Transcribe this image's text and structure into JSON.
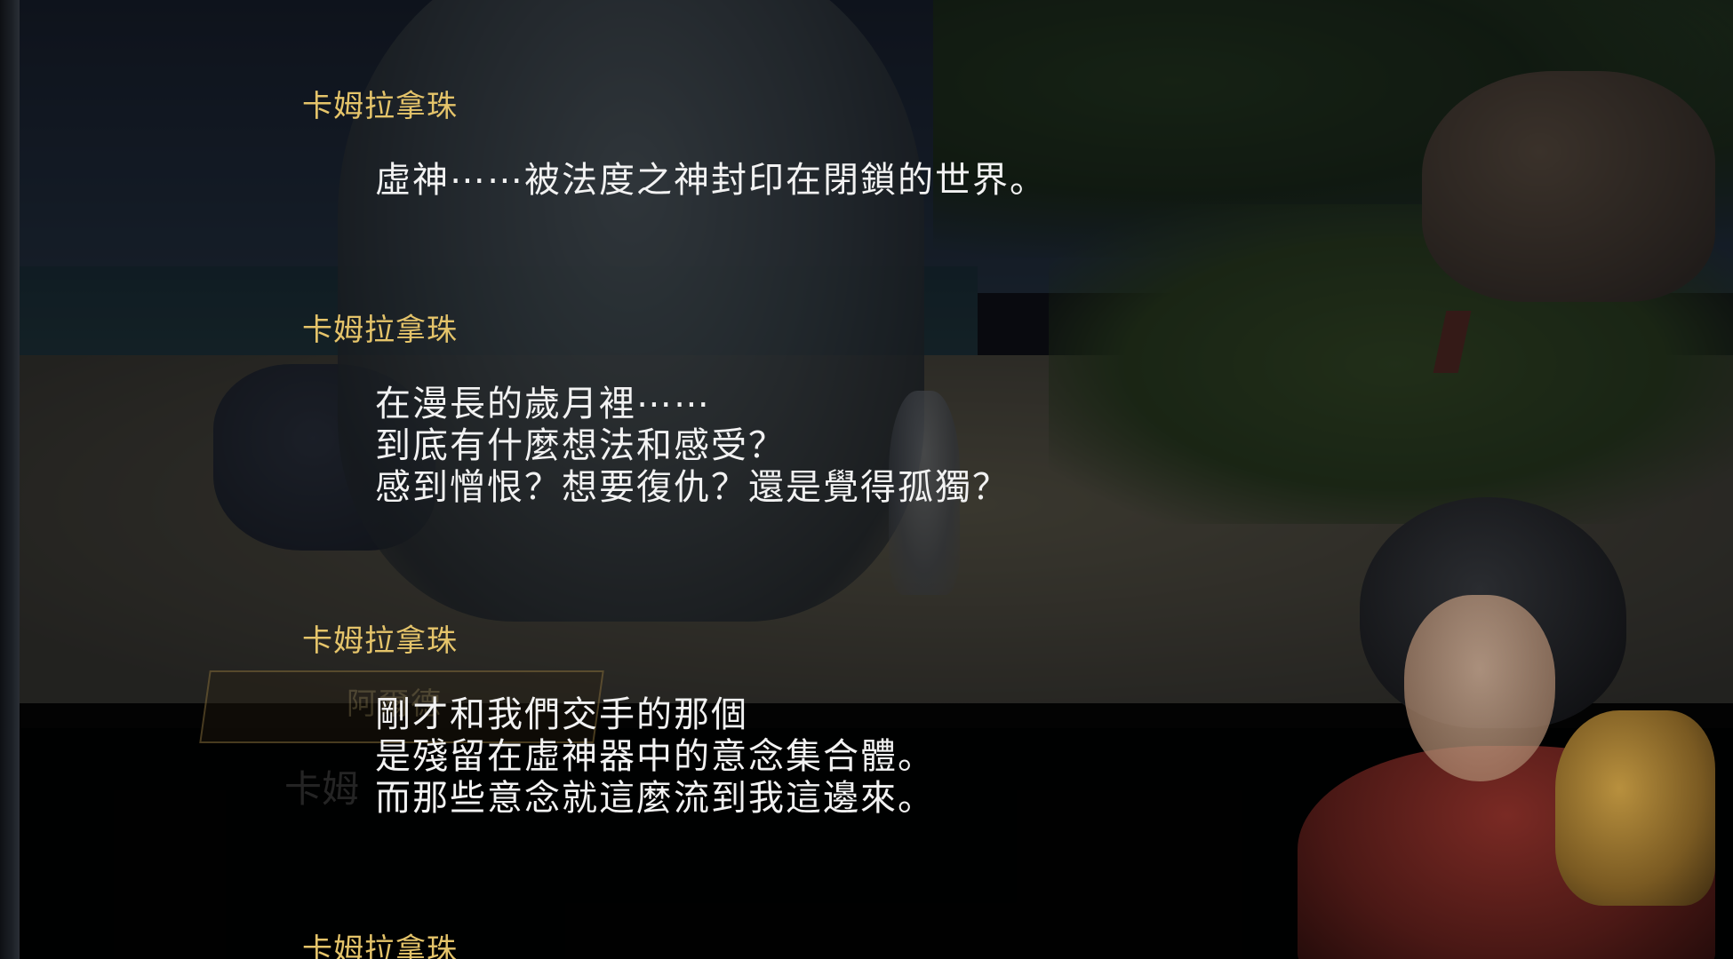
{
  "backlog": {
    "entries": [
      {
        "speaker": "卡姆拉拿珠",
        "lines": [
          "虛神⋯⋯被法度之神封印在閉鎖的世界。"
        ]
      },
      {
        "speaker": "卡姆拉拿珠",
        "lines": [
          "在漫長的歲月裡⋯⋯",
          "到底有什麼想法和感受？",
          "感到憎恨？想要復仇？還是覺得孤獨？"
        ]
      },
      {
        "speaker": "卡姆拉拿珠",
        "lines": [
          "剛才和我們交手的那個",
          "是殘留在虛神器中的意念集合體。",
          "而那些意念就這麼流到我這邊來。"
        ]
      },
      {
        "speaker": "卡姆拉拿珠",
        "lines": []
      }
    ]
  },
  "background": {
    "ghost_nameplate": "阿爾德",
    "ghost_speaker": "卡姆"
  },
  "colors": {
    "speaker_name": "#e5c46a",
    "dialogue_text": "#f2f2f2",
    "panel": "#000000"
  }
}
